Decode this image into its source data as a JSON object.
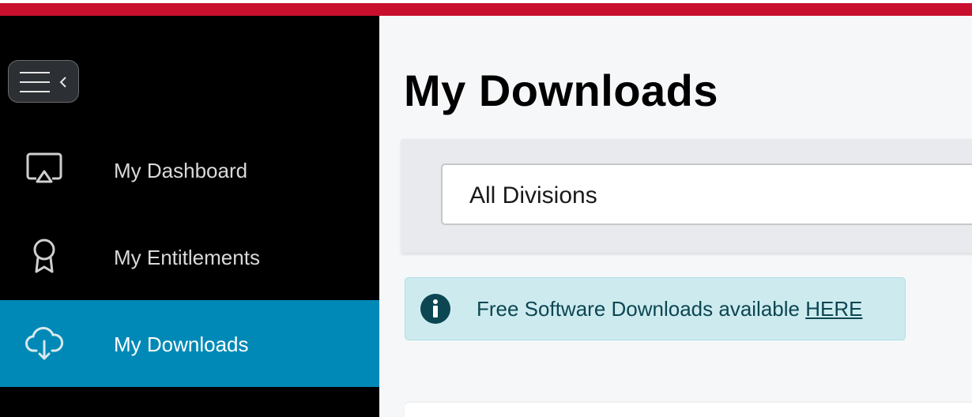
{
  "colors": {
    "brand_accent": "#c8102e",
    "sidebar_bg": "#000000",
    "sidebar_active": "#0089b6",
    "main_bg": "#f6f7f9",
    "alert_bg": "#cdebef",
    "alert_text": "#0c4652"
  },
  "sidebar": {
    "toggle_icon": "menu-collapse-icon",
    "items": [
      {
        "label": "My Dashboard",
        "icon": "monitor-icon",
        "active": false
      },
      {
        "label": "My Entitlements",
        "icon": "award-ribbon-icon",
        "active": false
      },
      {
        "label": "My Downloads",
        "icon": "cloud-download-icon",
        "active": true
      }
    ]
  },
  "main": {
    "title": "My Downloads",
    "division_select": {
      "selected": "All Divisions"
    },
    "alert": {
      "icon": "info-icon",
      "text": "Free Software Downloads available ",
      "link_text": "HERE"
    }
  }
}
